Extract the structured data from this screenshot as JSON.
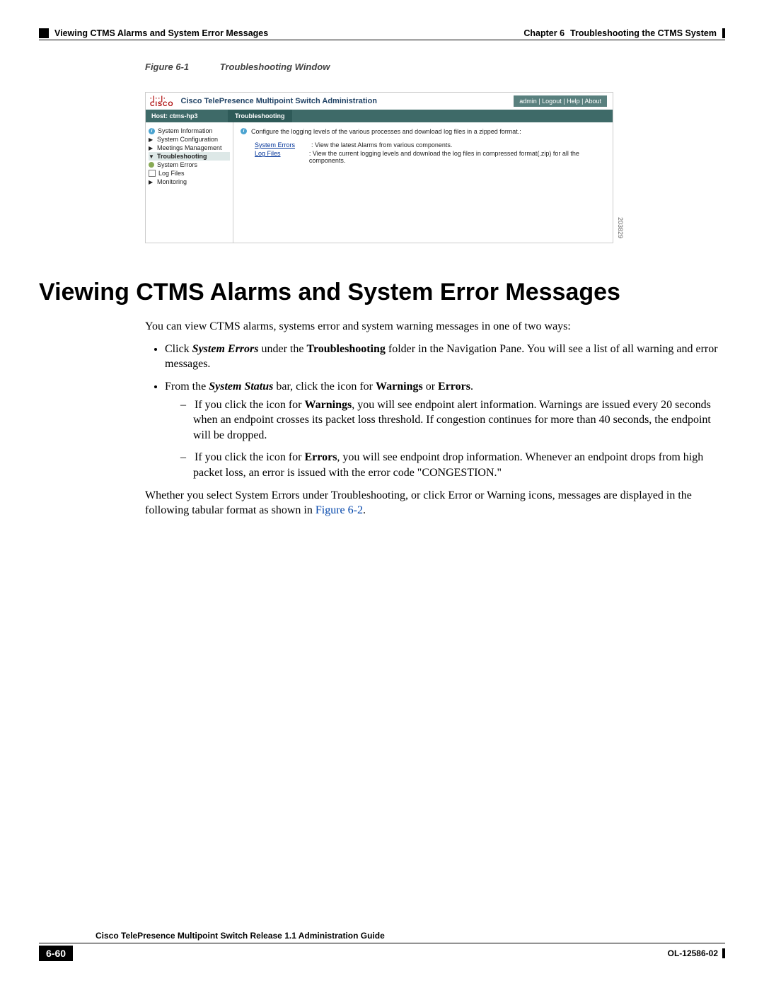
{
  "header": {
    "chapter_label": "Chapter 6",
    "chapter_title": "Troubleshooting the CTMS System",
    "section_path": "Viewing CTMS Alarms and System Error Messages"
  },
  "figure": {
    "label": "Figure 6-1",
    "title": "Troubleshooting Window",
    "side_num": "203829"
  },
  "app": {
    "logo_top": "·|··|·",
    "logo_bottom": "CISCO",
    "product_title": "Cisco TelePresence Multipoint Switch Administration",
    "user": "admin",
    "links": [
      "Logout",
      "Help",
      "About"
    ],
    "host_label": "Host: ctms-hp3",
    "tab": "Troubleshooting",
    "sidebar": {
      "items": [
        {
          "icon": "info",
          "label": "System Information"
        },
        {
          "icon": "tri",
          "label": "System Configuration"
        },
        {
          "icon": "tri",
          "label": "Meetings Management"
        },
        {
          "icon": "tri-down",
          "label": "Troubleshooting",
          "selected": true
        },
        {
          "icon": "gear",
          "label": "System Errors",
          "sub": true
        },
        {
          "icon": "file",
          "label": "Log Files",
          "sub": true
        },
        {
          "icon": "tri",
          "label": "Monitoring"
        }
      ]
    },
    "content": {
      "intro": "Configure the logging levels of the various processes and download log files in a zipped format.:",
      "rows": [
        {
          "link": "System Errors",
          "text": ": View the latest Alarms from various components."
        },
        {
          "link": "Log Files",
          "text": ": View the current logging levels and download the log files in compressed format(.zip) for all the components."
        }
      ]
    }
  },
  "section_heading": "Viewing CTMS Alarms and System Error Messages",
  "para_intro": "You can view CTMS alarms, systems error and system warning messages in one of two ways:",
  "bullets": [
    {
      "pre": "Click ",
      "b1": "System Errors",
      "mid": " under the ",
      "b2": "Troubleshooting",
      "post": " folder in the Navigation Pane. You will see a list of all warning and error messages."
    },
    {
      "pre": "From the ",
      "b1": "System Status",
      "mid": " bar, click the icon for ",
      "b2": "Warnings",
      "mid2": " or ",
      "b3": "Errors",
      "post": "."
    }
  ],
  "sub_bullets": [
    {
      "pre": "If you click the icon for ",
      "b": "Warnings",
      "post": ", you will see endpoint alert information. Warnings are issued every 20 seconds when an endpoint crosses its packet loss threshold. If congestion continues for more than 40 seconds, the endpoint will be dropped."
    },
    {
      "pre": "If you click the icon for ",
      "b": "Errors",
      "post": ", you will see endpoint drop information. Whenever an endpoint drops from high packet loss, an error is issued with the error code \"CONGESTION.\""
    }
  ],
  "para_closing_pre": "Whether you select System Errors under Troubleshooting, or click Error or Warning icons, messages are displayed in the following tabular format as shown in ",
  "para_closing_link": "Figure 6-2",
  "para_closing_post": ".",
  "footer": {
    "guide": "Cisco TelePresence Multipoint Switch Release 1.1 Administration Guide",
    "page": "6-60",
    "doc": "OL-12586-02"
  }
}
